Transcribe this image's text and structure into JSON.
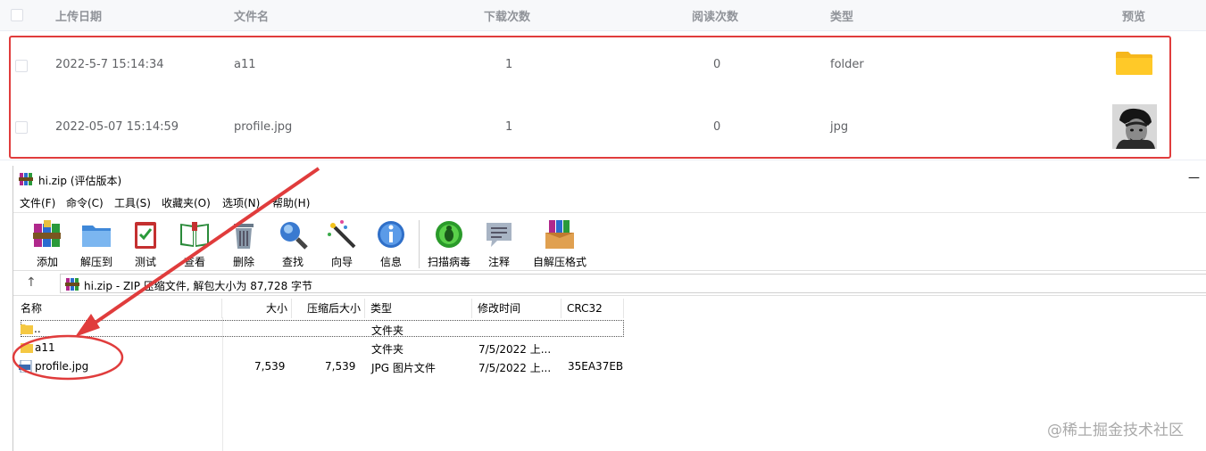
{
  "web_table": {
    "headers": [
      "上传日期",
      "文件名",
      "下载次数",
      "阅读次数",
      "类型",
      "预览"
    ],
    "rows": [
      {
        "date": "2022-5-7 15:14:34",
        "name": "a11",
        "downloads": "1",
        "reads": "0",
        "type": "folder"
      },
      {
        "date": "2022-05-07 15:14:59",
        "name": "profile.jpg",
        "downloads": "1",
        "reads": "0",
        "type": "jpg"
      }
    ]
  },
  "winrar": {
    "title": "hi.zip (评估版本)",
    "minimize": "—",
    "menu": [
      "文件(F)",
      "命令(C)",
      "工具(S)",
      "收藏夹(O)",
      "选项(N)",
      "帮助(H)"
    ],
    "toolbar": [
      "添加",
      "解压到",
      "测试",
      "查看",
      "删除",
      "查找",
      "向导",
      "信息",
      "扫描病毒",
      "注释",
      "自解压格式"
    ],
    "address": "hi.zip - ZIP 压缩文件, 解包大小为 87,728 字节",
    "up_arrow": "↑",
    "columns": [
      "名称",
      "大小",
      "压缩后大小",
      "类型",
      "修改时间",
      "CRC32"
    ],
    "rows": [
      {
        "name": "..",
        "size": "",
        "packed": "",
        "type": "文件夹",
        "modified": "",
        "crc": ""
      },
      {
        "name": "a11",
        "size": "",
        "packed": "",
        "type": "文件夹",
        "modified": "7/5/2022 上...",
        "crc": ""
      },
      {
        "name": "profile.jpg",
        "size": "7,539",
        "packed": "7,539",
        "type": "JPG 图片文件",
        "modified": "7/5/2022 上...",
        "crc": "35EA37EB"
      }
    ]
  },
  "watermark": "@稀土掘金技术社区",
  "colors": {
    "annotation": "#e03c3c",
    "folder": "#ffc928",
    "header_text": "#909399"
  }
}
